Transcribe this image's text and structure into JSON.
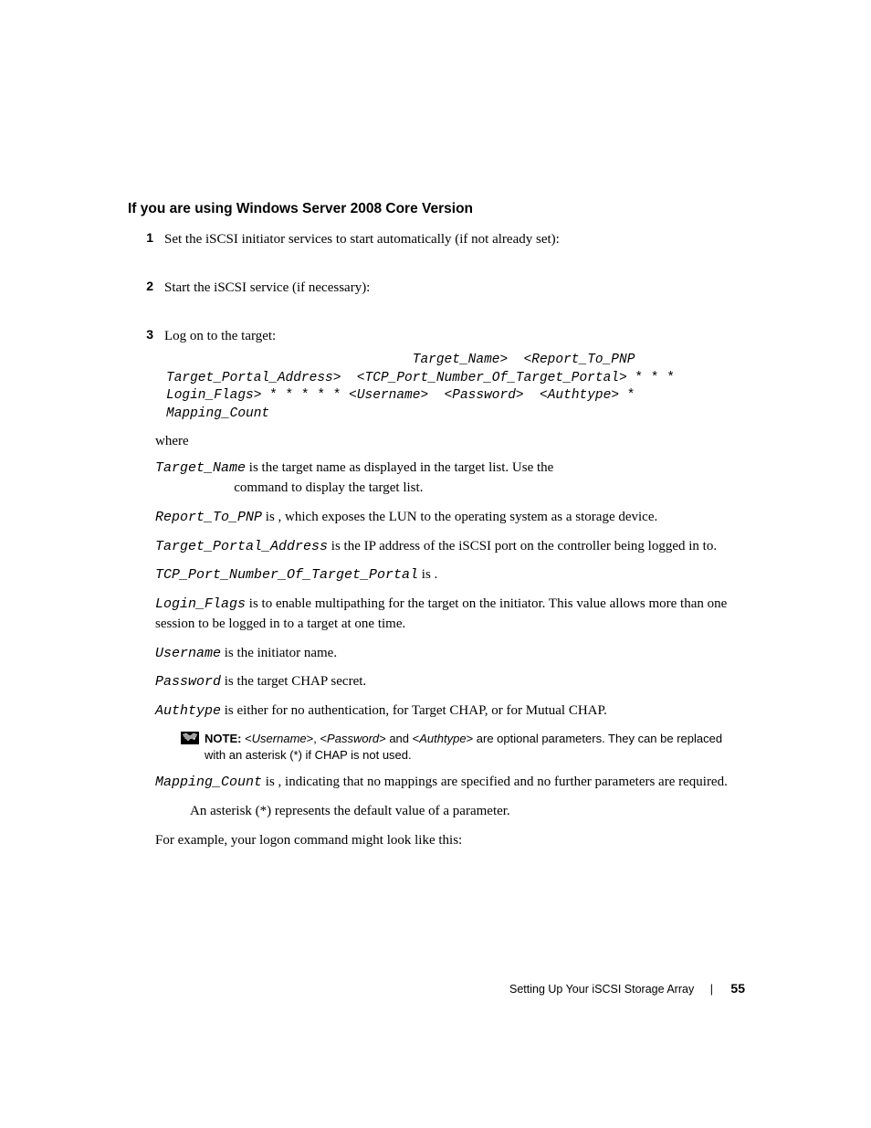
{
  "heading": "If you are using Windows Server 2008 Core Version",
  "steps": {
    "s1": {
      "num": "1",
      "text": "Set the iSCSI initiator services to start automatically (if not already set):"
    },
    "s2": {
      "num": "2",
      "text": "Start the iSCSI service (if necessary):"
    },
    "s3": {
      "num": "3",
      "text": "Log on to the target:"
    }
  },
  "code": {
    "l1a": "                               Target_Name",
    "l1b": ">  <",
    "l1c": "Report_To_PNP",
    "l2a": "Target_Portal_Address",
    "l2b": ">  <",
    "l2c": "TCP_Port_Number_Of_Target_Portal",
    "l2d": "> * * *",
    "l3a": "Login_Flags",
    "l3b": "> * * * * * <",
    "l3c": "Username",
    "l3d": ">  <",
    "l3e": "Password",
    "l3f": ">  <",
    "l3g": "Authtype",
    "l3h": "> *",
    "l4a": "Mapping_Count"
  },
  "where": "where",
  "params": {
    "target_name": {
      "var": "Target_Name",
      "t1": " is the target name as displayed in the target list. Use the ",
      "t2": "command to display the target list."
    },
    "report_to_pnp": {
      "var": "Report_To_PNP",
      "t1": " is  , which exposes the LUN to the operating system as a storage device."
    },
    "tpa": {
      "var": "Target_Portal_Address",
      "t1": " is the IP address of the iSCSI port on the controller being logged in to."
    },
    "tcp_port": {
      "var": "TCP_Port_Number_Of_Target_Portal",
      "t1": " is        ."
    },
    "login_flags": {
      "var": "Login_Flags",
      "t1": " is       to enable multipathing for the target on the initiator. This value allows more than one session to be logged in to a target at one time."
    },
    "username": {
      "var": "Username",
      "t1": " is the initiator name."
    },
    "password": {
      "var": "Password",
      "t1": " is the target CHAP secret."
    },
    "authtype": {
      "var": "Authtype",
      "t1": " is either    for no authentication,    for Target CHAP, or    for Mutual CHAP."
    },
    "mapping_count": {
      "var": "Mapping_Count",
      "t1": " is   , indicating that no mappings are specified and no further parameters are required."
    }
  },
  "note": {
    "label": "NOTE: ",
    "p1": "<",
    "v1": "Username",
    "p2": ">, <",
    "v2": "Password",
    "p3": "> and <",
    "v3": "Authtype",
    "p4": "> are optional parameters. They can be replaced with an asterisk (*) if CHAP is not used."
  },
  "asterisk_line": "An asterisk (*) represents the default value of a parameter.",
  "example_line": "For example, your logon command might look like this:",
  "footer": {
    "title": "Setting Up Your iSCSI Storage Array",
    "page": "55"
  }
}
